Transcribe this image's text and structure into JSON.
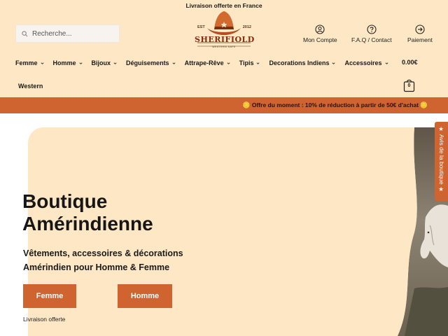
{
  "topbar": {
    "text": "Livraison offerte en France"
  },
  "search": {
    "placeholder": "Recherche..."
  },
  "logo": {
    "brand": "SHERIFIOLD",
    "est": "EST",
    "year": "2012",
    "tagline": "WESTERN SAFE"
  },
  "account": {
    "my_account": "Mon Compte",
    "faq": "F.A.Q / Contact",
    "payment": "Paiement"
  },
  "nav": {
    "items": [
      {
        "label": "Femme"
      },
      {
        "label": "Homme"
      },
      {
        "label": "Bijoux"
      },
      {
        "label": "Déguisements"
      },
      {
        "label": "Attrape-Rêve"
      },
      {
        "label": "Tipis"
      },
      {
        "label": "Decorations Indiens"
      },
      {
        "label": "Accessoires"
      }
    ],
    "western": "Western"
  },
  "cart": {
    "total": "0.00€",
    "count": "0"
  },
  "promo": {
    "text": "🪙 Offre du moment : 10% de réduction à partir de 50€ d'achat 🪙"
  },
  "hero": {
    "title": "Boutique Amérindienne",
    "subtitle": "Vêtements, accessoires & décorations Amérindien pour Homme & Femme",
    "btn_women": "Femme",
    "btn_men": "Homme",
    "shipping": "Livraison offerte"
  },
  "reviews_tab": {
    "label": "★ Avis de la boutique ★"
  },
  "colors": {
    "accent": "#cf6431",
    "background": "#fde7c4",
    "brand": "#8b2a0f"
  }
}
